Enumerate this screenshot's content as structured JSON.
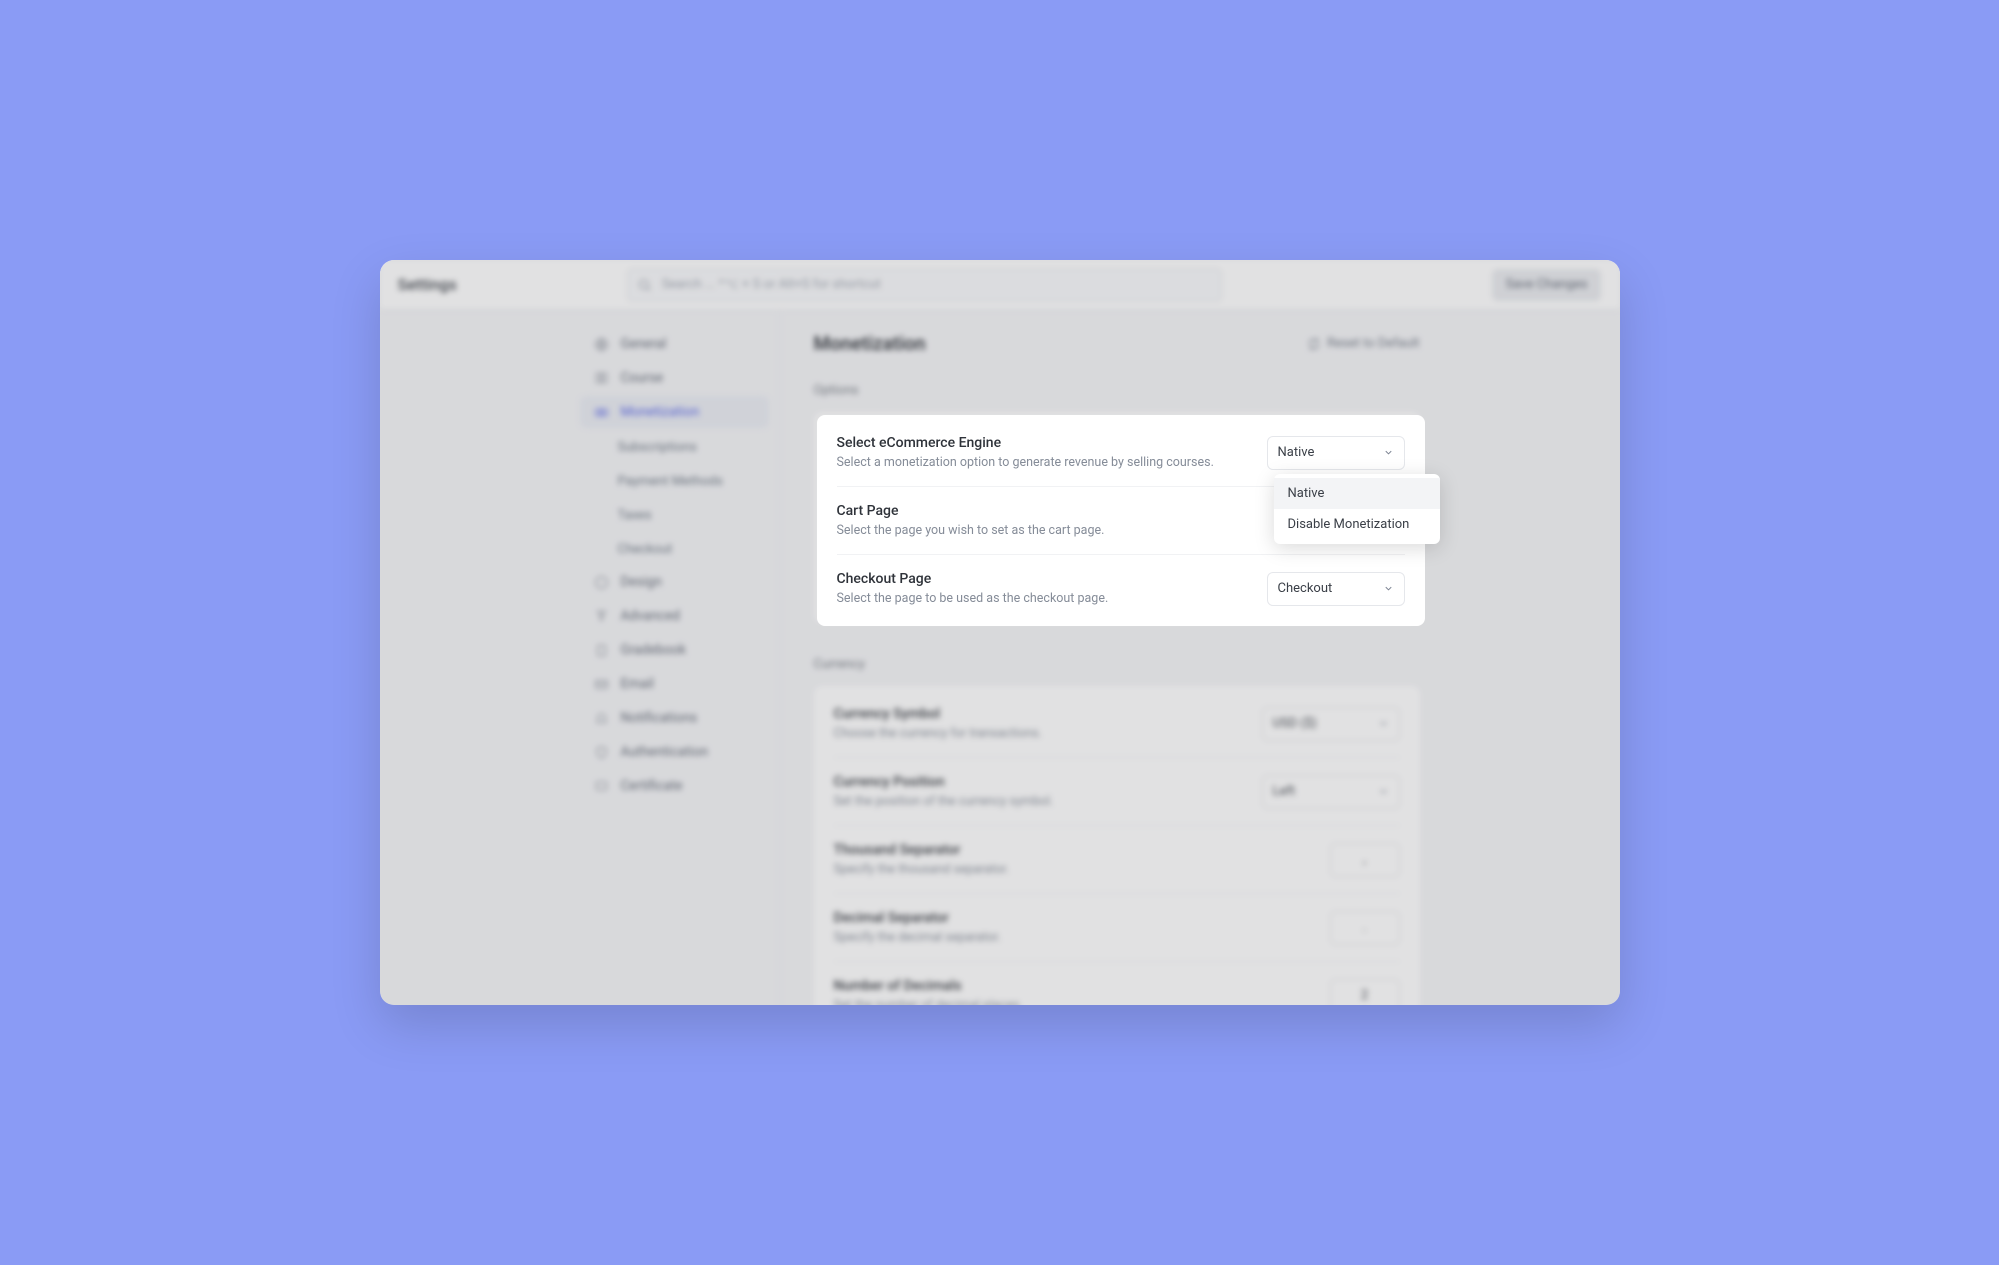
{
  "header": {
    "title": "Settings",
    "search_placeholder": "Search ... ^⌥ + S or Alt+S for shortcut",
    "save_label": "Save Changes"
  },
  "sidebar": {
    "items": [
      {
        "label": "General",
        "icon": "globe"
      },
      {
        "label": "Course",
        "icon": "book"
      },
      {
        "label": "Monetization",
        "icon": "cash",
        "active": true,
        "sub": [
          "Subscriptions",
          "Payment Methods",
          "Taxes",
          "Checkout"
        ]
      },
      {
        "label": "Design",
        "icon": "palette"
      },
      {
        "label": "Advanced",
        "icon": "filter"
      },
      {
        "label": "Gradebook",
        "icon": "clipboard"
      },
      {
        "label": "Email",
        "icon": "mail"
      },
      {
        "label": "Notifications",
        "icon": "bell"
      },
      {
        "label": "Authentication",
        "icon": "shield"
      },
      {
        "label": "Certificate",
        "icon": "badge"
      }
    ]
  },
  "main": {
    "title": "Monetization",
    "reset_label": "Reset to Default",
    "sections": {
      "options": {
        "label": "Options",
        "rows": [
          {
            "title": "Select eCommerce Engine",
            "desc": "Select a monetization option to generate revenue by selling courses.",
            "value": "Native"
          },
          {
            "title": "Cart Page",
            "desc": "Select the page you wish to set as the cart page.",
            "value": ""
          },
          {
            "title": "Checkout Page",
            "desc": "Select the page to be used as the checkout page.",
            "value": "Checkout"
          }
        ]
      },
      "currency": {
        "label": "Currency",
        "rows": [
          {
            "title": "Currency Symbol",
            "desc": "Choose the currency for transactions.",
            "value": "USD ($)"
          },
          {
            "title": "Currency Position",
            "desc": "Set the position of the currency symbol.",
            "value": "Left"
          },
          {
            "title": "Thousand Separator",
            "desc": "Specify the thousand separator.",
            "value": ","
          },
          {
            "title": "Decimal Separator",
            "desc": "Specify the decimal separator.",
            "value": "."
          },
          {
            "title": "Number of Decimals",
            "desc": "Set the number of decimal places.",
            "value": "2"
          }
        ]
      }
    },
    "dropdown": {
      "options": [
        "Native",
        "Disable Monetization"
      ],
      "selected": "Native"
    }
  }
}
